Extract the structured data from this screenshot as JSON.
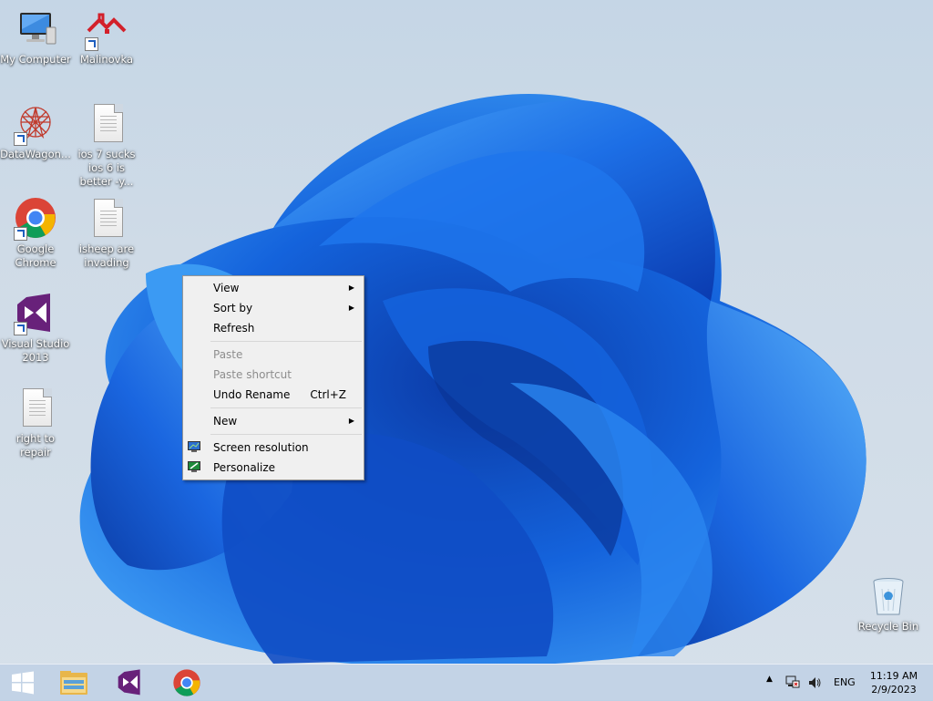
{
  "desktop": {
    "icons": [
      {
        "label": "My Computer"
      },
      {
        "label": "Malinovka"
      },
      {
        "label": "DataWagon..."
      },
      {
        "label": "ios 7 sucks ios 6 is better -y..."
      },
      {
        "label": "Google Chrome"
      },
      {
        "label": "isheep are invading"
      },
      {
        "label": "Visual Studio 2013"
      },
      {
        "label": "right to repair"
      },
      {
        "label": "Recycle Bin"
      }
    ]
  },
  "context_menu": {
    "items": [
      {
        "label": "View",
        "has_submenu": true
      },
      {
        "label": "Sort by",
        "has_submenu": true
      },
      {
        "label": "Refresh"
      },
      {
        "label": "Paste",
        "disabled": true
      },
      {
        "label": "Paste shortcut",
        "disabled": true
      },
      {
        "label": "Undo Rename",
        "shortcut": "Ctrl+Z"
      },
      {
        "label": "New",
        "has_submenu": true
      },
      {
        "label": "Screen resolution",
        "icon": "monitor-icon"
      },
      {
        "label": "Personalize",
        "icon": "personalize-icon"
      }
    ]
  },
  "taskbar": {
    "pinned": [
      "start-button",
      "file-explorer-icon",
      "visual-studio-icon",
      "chrome-icon"
    ],
    "tray": {
      "language": "ENG",
      "time": "11:19 AM",
      "date": "2/9/2023"
    }
  },
  "colors": {
    "wallpaper_bg": "#cfdbe7",
    "bloom_dark": "#0a3fb8",
    "bloom_light": "#2f8cf0",
    "menu_bg": "#f0f0f0"
  }
}
